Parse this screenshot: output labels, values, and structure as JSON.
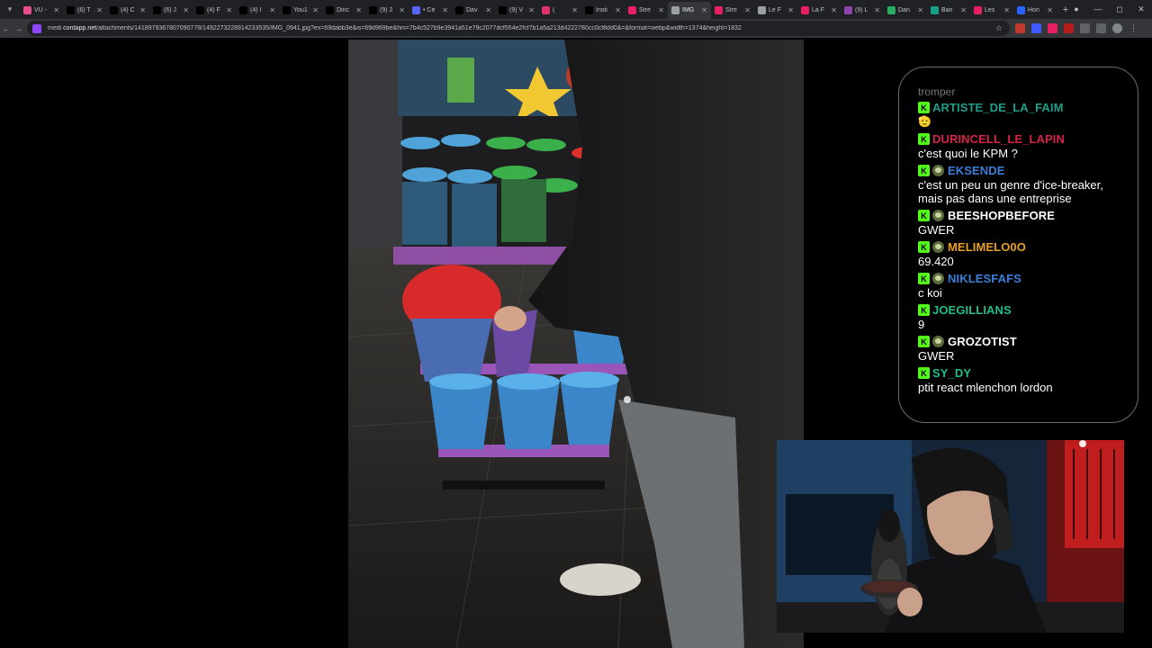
{
  "tabs": [
    {
      "label": "VU -",
      "favicon": "#e74c8b"
    },
    {
      "label": "(6) T",
      "favicon": "#000000"
    },
    {
      "label": "(4) C",
      "favicon": "#000000"
    },
    {
      "label": "(6) J",
      "favicon": "#000000"
    },
    {
      "label": "(4) F",
      "favicon": "#000000"
    },
    {
      "label": "(4) I",
      "favicon": "#000000"
    },
    {
      "label": "You1",
      "favicon": "#000000"
    },
    {
      "label": "Dinc",
      "favicon": "#000000"
    },
    {
      "label": "(9) 2",
      "favicon": "#000000"
    },
    {
      "label": "• Ce",
      "favicon": "#5865f2"
    },
    {
      "label": "Dav",
      "favicon": "#000000"
    },
    {
      "label": "(9) V",
      "favicon": "#000000"
    },
    {
      "label": "(",
      "favicon": "#e1306c"
    },
    {
      "label": "Insti",
      "favicon": "#000000"
    },
    {
      "label": "Stre",
      "favicon": "#e91e63"
    },
    {
      "label": "IMG",
      "favicon": "#9aa0a6",
      "active": true
    },
    {
      "label": "Stre",
      "favicon": "#e91e63"
    },
    {
      "label": "Le F",
      "favicon": "#9aa0a6"
    },
    {
      "label": "La F",
      "favicon": "#e91e63"
    },
    {
      "label": "(9) L",
      "favicon": "#8e44ad"
    },
    {
      "label": "Dan",
      "favicon": "#27ae60"
    },
    {
      "label": "Ban",
      "favicon": "#16a085"
    },
    {
      "label": "Les",
      "favicon": "#e91e63"
    },
    {
      "label": "Hon",
      "favicon": "#2962ff"
    }
  ],
  "address": {
    "prefix": "medi",
    "host": "cordapp.net",
    "path": "/attachments/1418979367807090778/1492273228914233535/IMG_0941.jpg?ex=69dabb3e&is=69d969be&hm=7b4c527b9e3941a51e79c2077dcf554e2fcf7b1a5a213d4222780cc0cf8dd0&=&format=webp&width=1374&height=1832"
  },
  "chat": {
    "faded_text": "tromper",
    "messages": [
      {
        "user": "ARTISTE_DE_LA_FAIM",
        "color": "#1f9e8a",
        "badges": [
          "k"
        ],
        "text": "",
        "emoji": "🫡"
      },
      {
        "user": "DURINCELL_LE_LAPIN",
        "color": "#d4244a",
        "badges": [
          "k"
        ],
        "text": "c'est quoi le KPM ?"
      },
      {
        "user": "EKSENDE",
        "color": "#3b7fd9",
        "badges": [
          "k",
          "g"
        ],
        "text": "c'est un peu un genre d'ice-breaker, mais pas dans une entreprise"
      },
      {
        "user": "BEESHOPBEFORE",
        "color": "#ffffff",
        "badges": [
          "k",
          "g"
        ],
        "text": "GWER"
      },
      {
        "user": "MELIMELO0O",
        "color": "#e9a020",
        "badges": [
          "k",
          "g"
        ],
        "text": "69.420"
      },
      {
        "user": "NIKLESFAFS",
        "color": "#3b7fd9",
        "badges": [
          "k",
          "g"
        ],
        "text": "c koi"
      },
      {
        "user": "JOEGILLIANS",
        "color": "#1fbf8a",
        "badges": [
          "k"
        ],
        "text": "9"
      },
      {
        "user": "GROZOTIST",
        "color": "#ffffff",
        "badges": [
          "k",
          "g"
        ],
        "text": "GWER"
      },
      {
        "user": "SY_DY",
        "color": "#1fbf8a",
        "badges": [
          "k"
        ],
        "text": "ptit react mlenchon lordon"
      }
    ]
  },
  "colors": {
    "tabstrip": "#202124",
    "toolbar": "#35363a",
    "kick_badge": "#53fc18"
  }
}
